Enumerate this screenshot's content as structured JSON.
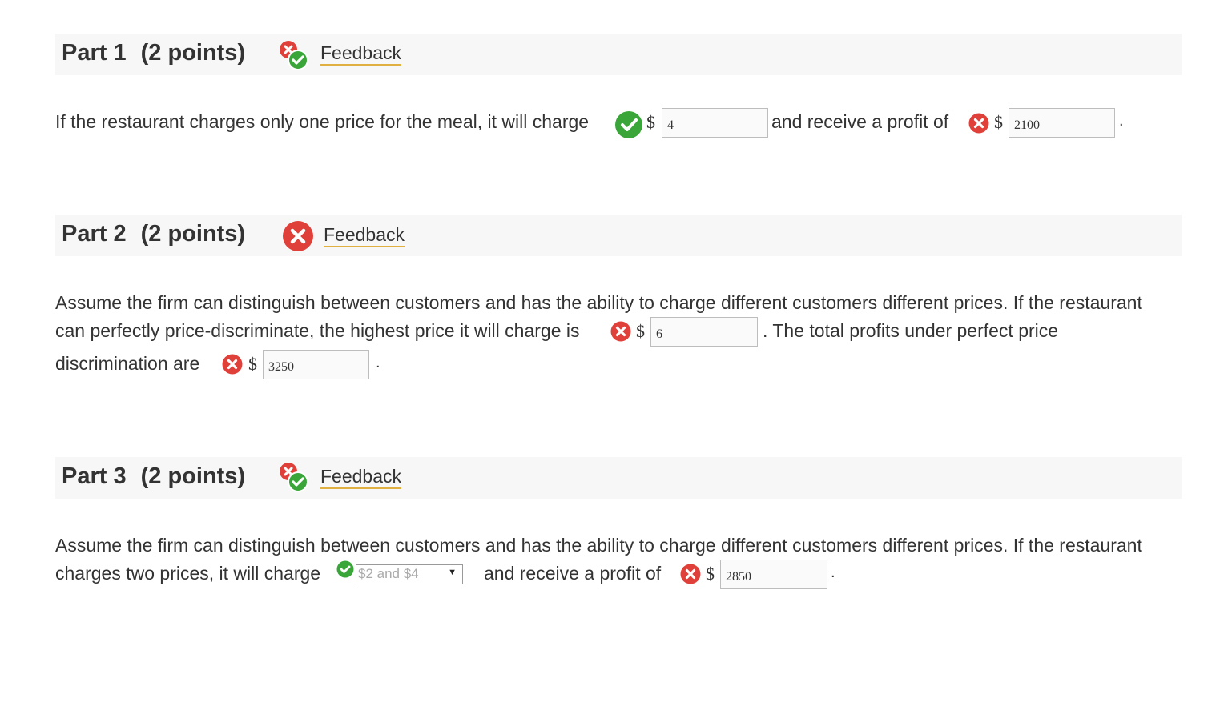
{
  "currency_symbol": "$",
  "period": ".",
  "colors": {
    "correct": "#3aa63a",
    "incorrect": "#e0403a",
    "feedback_underline": "#e0b040",
    "header_bg": "#f7f7f7"
  },
  "parts": [
    {
      "title": "Part 1",
      "points": "(2 points)",
      "status_icon": "mixed-correct-incorrect-icon",
      "feedback_label": "Feedback",
      "text_1": "If the restaurant charges only one price for the meal, it will charge",
      "answer_1": {
        "value": "4",
        "status": "correct"
      },
      "text_2": "and receive a profit of",
      "answer_2": {
        "value": "2100",
        "status": "incorrect"
      }
    },
    {
      "title": "Part 2",
      "points": "(2 points)",
      "status_icon": "incorrect-icon",
      "feedback_label": "Feedback",
      "line_1": "Assume the firm can distinguish between customers and has the ability to charge different customers different prices. If the restaurant",
      "line_2a": "can perfectly price-discriminate, the highest price it will charge is",
      "answer_1": {
        "value": "6",
        "status": "incorrect"
      },
      "line_2b": ". The total profits under perfect price",
      "line_3": "discrimination are",
      "answer_2": {
        "value": "3250",
        "status": "incorrect"
      }
    },
    {
      "title": "Part 3",
      "points": "(2 points)",
      "status_icon": "mixed-correct-incorrect-icon",
      "feedback_label": "Feedback",
      "line_1": "Assume the firm can distinguish between customers and has the ability to charge different customers different prices. If the restaurant",
      "line_2a": "charges two prices, it will charge",
      "select_1": {
        "selected": "$2 and $4",
        "status": "correct"
      },
      "line_2b": "and receive a profit of",
      "answer_2": {
        "value": "2850",
        "status": "incorrect"
      }
    }
  ]
}
